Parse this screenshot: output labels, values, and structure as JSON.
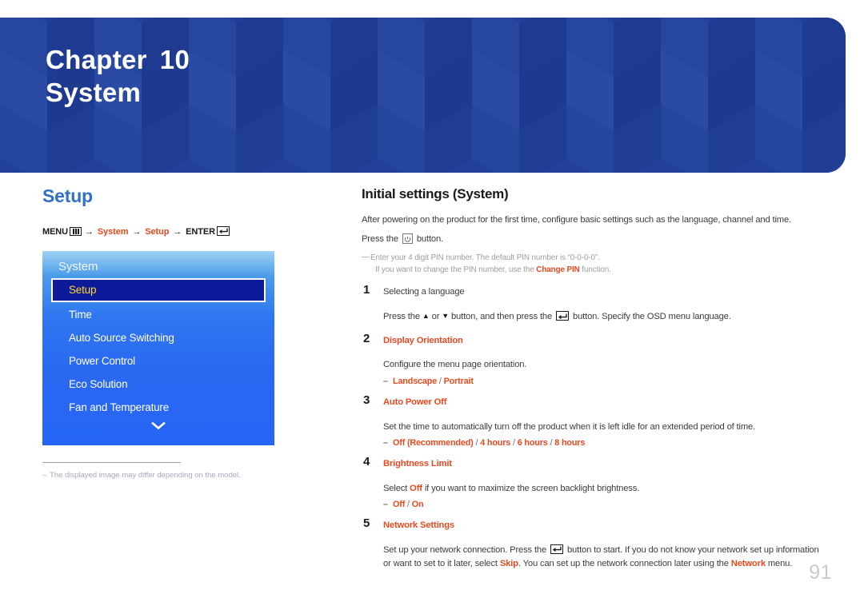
{
  "banner": {
    "chapter_label": "Chapter",
    "chapter_number": "10",
    "chapter_name": "System",
    "bg_color": "#22409a"
  },
  "left": {
    "section_title": "Setup",
    "menu_path": {
      "menu_label": "MENU",
      "menu_icon": "menu-grid-icon",
      "arrow": "→",
      "step1": "System",
      "step2": "Setup",
      "enter_label": "ENTER",
      "enter_icon": "enter-return-icon",
      "accent_color": "#e8491f"
    },
    "osd": {
      "header": "System",
      "items": [
        {
          "label": "Setup",
          "selected": true
        },
        {
          "label": "Time",
          "selected": false
        },
        {
          "label": "Auto Source Switching",
          "selected": false
        },
        {
          "label": "Power Control",
          "selected": false
        },
        {
          "label": "Eco Solution",
          "selected": false
        },
        {
          "label": "Fan and Temperature",
          "selected": false
        }
      ],
      "more_icon": "chevron-down-icon",
      "selected_bg": "#0c1a9a",
      "selected_text_color": "#ffd62b"
    },
    "footnote": {
      "dash": "–",
      "text": "The displayed image may differ depending on the model."
    }
  },
  "right": {
    "title": "Initial settings (System)",
    "intro_paragraph": "After powering on the product for the first time, configure basic settings such as the language, channel and time.",
    "press_button_prefix": "Press the",
    "press_button_icon": "power-button-icon",
    "press_button_suffix": "button.",
    "pin_note_line1": "Enter your 4 digit PIN number. The default PIN number is “0-0-0-0”.",
    "pin_note_line2_pre": "If you want to change the PIN number, use the",
    "pin_note_line2_accent": "Change PIN",
    "pin_note_line2_post": "function.",
    "steps": [
      {
        "num": "1",
        "head": "Selecting a language",
        "head_accent": false,
        "body_pre": "Press the",
        "body_mid1": "or",
        "body_mid2": "button, and then press the",
        "body_post": "button. Specify the OSD menu language.",
        "options": []
      },
      {
        "num": "2",
        "head": "Display Orientation",
        "head_accent": true,
        "body": "Configure the menu page orientation.",
        "options": [
          {
            "dash": "–",
            "parts": [
              "Landscape",
              "Portrait"
            ]
          }
        ]
      },
      {
        "num": "3",
        "head": "Auto Power Off",
        "head_accent": true,
        "body": "Set the time to automatically turn off the product when it is left idle for an extended period of time.",
        "options": [
          {
            "dash": "–",
            "parts": [
              "Off (Recommended)",
              "4 hours",
              "6 hours",
              "8 hours"
            ]
          }
        ]
      },
      {
        "num": "4",
        "head": "Brightness Limit",
        "head_accent": true,
        "body_pre": "Select",
        "body_accent": "Off",
        "body_post": "if you want to maximize the screen backlight brightness.",
        "options": [
          {
            "dash": "–",
            "parts": [
              "Off",
              "On"
            ]
          }
        ]
      },
      {
        "num": "5",
        "head": "Network Settings",
        "head_accent": true,
        "body_p1": "Set up your network connection. Press the",
        "body_p2": "button to start. If you do not know your network set up information or want to set to it later, select",
        "body_accent1": "Skip",
        "body_p3": ". You can set up the network connection later using the",
        "body_accent2": "Network",
        "body_p4": "menu.",
        "options": []
      }
    ],
    "up_arrow": "▲",
    "down_arrow": "▼"
  },
  "page_number": "91"
}
